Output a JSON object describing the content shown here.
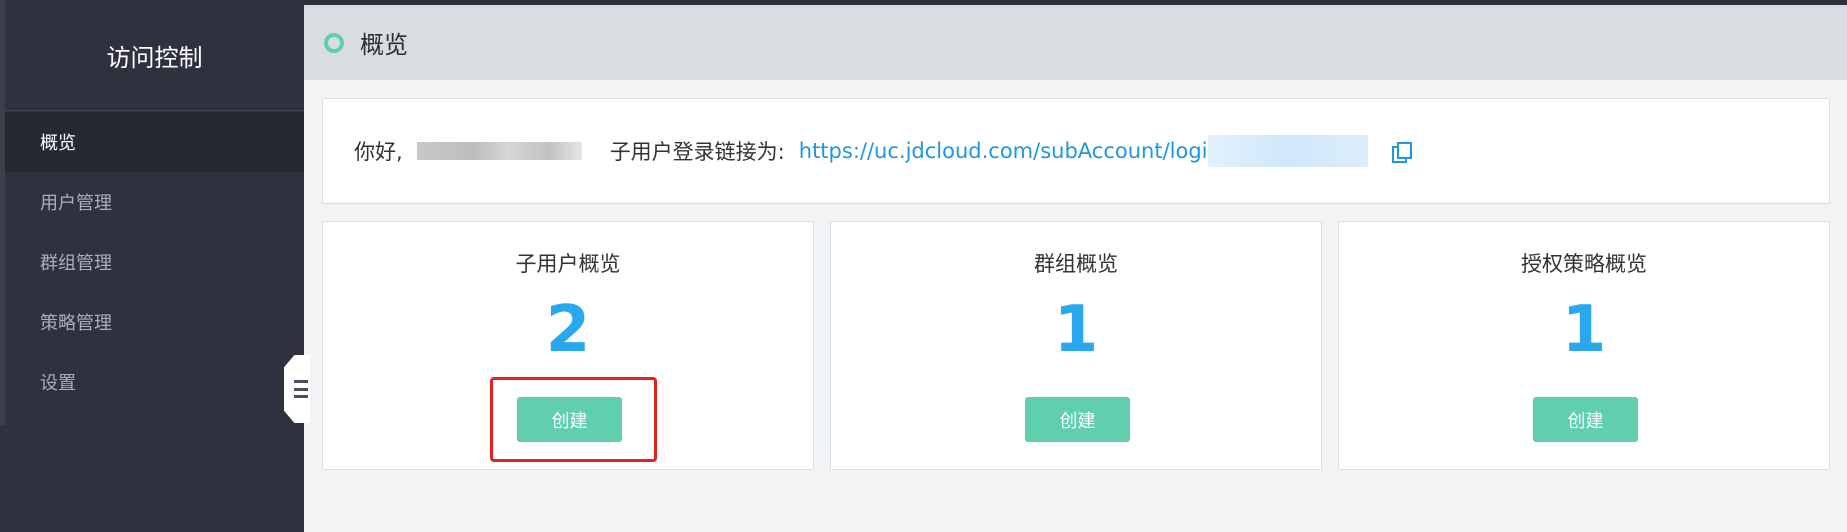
{
  "sidebar": {
    "title": "访问控制",
    "items": [
      {
        "label": "概览"
      },
      {
        "label": "用户管理"
      },
      {
        "label": "群组管理"
      },
      {
        "label": "策略管理"
      },
      {
        "label": "设置"
      }
    ]
  },
  "header": {
    "title": "概览"
  },
  "greeting": {
    "hello": "你好,",
    "login_label": "子用户登录链接为:",
    "login_link": "https://uc.jdcloud.com/subAccount/logi"
  },
  "cards": [
    {
      "title": "子用户概览",
      "count": "2",
      "button": "创建"
    },
    {
      "title": "群组概览",
      "count": "1",
      "button": "创建"
    },
    {
      "title": "授权策略概览",
      "count": "1",
      "button": "创建"
    }
  ],
  "colors": {
    "sidebar_bg": "#2f323e",
    "accent_green": "#5fcfae",
    "count_blue": "#2aa8ee",
    "link_blue": "#1e96e0",
    "highlight_red": "#e5221b"
  }
}
